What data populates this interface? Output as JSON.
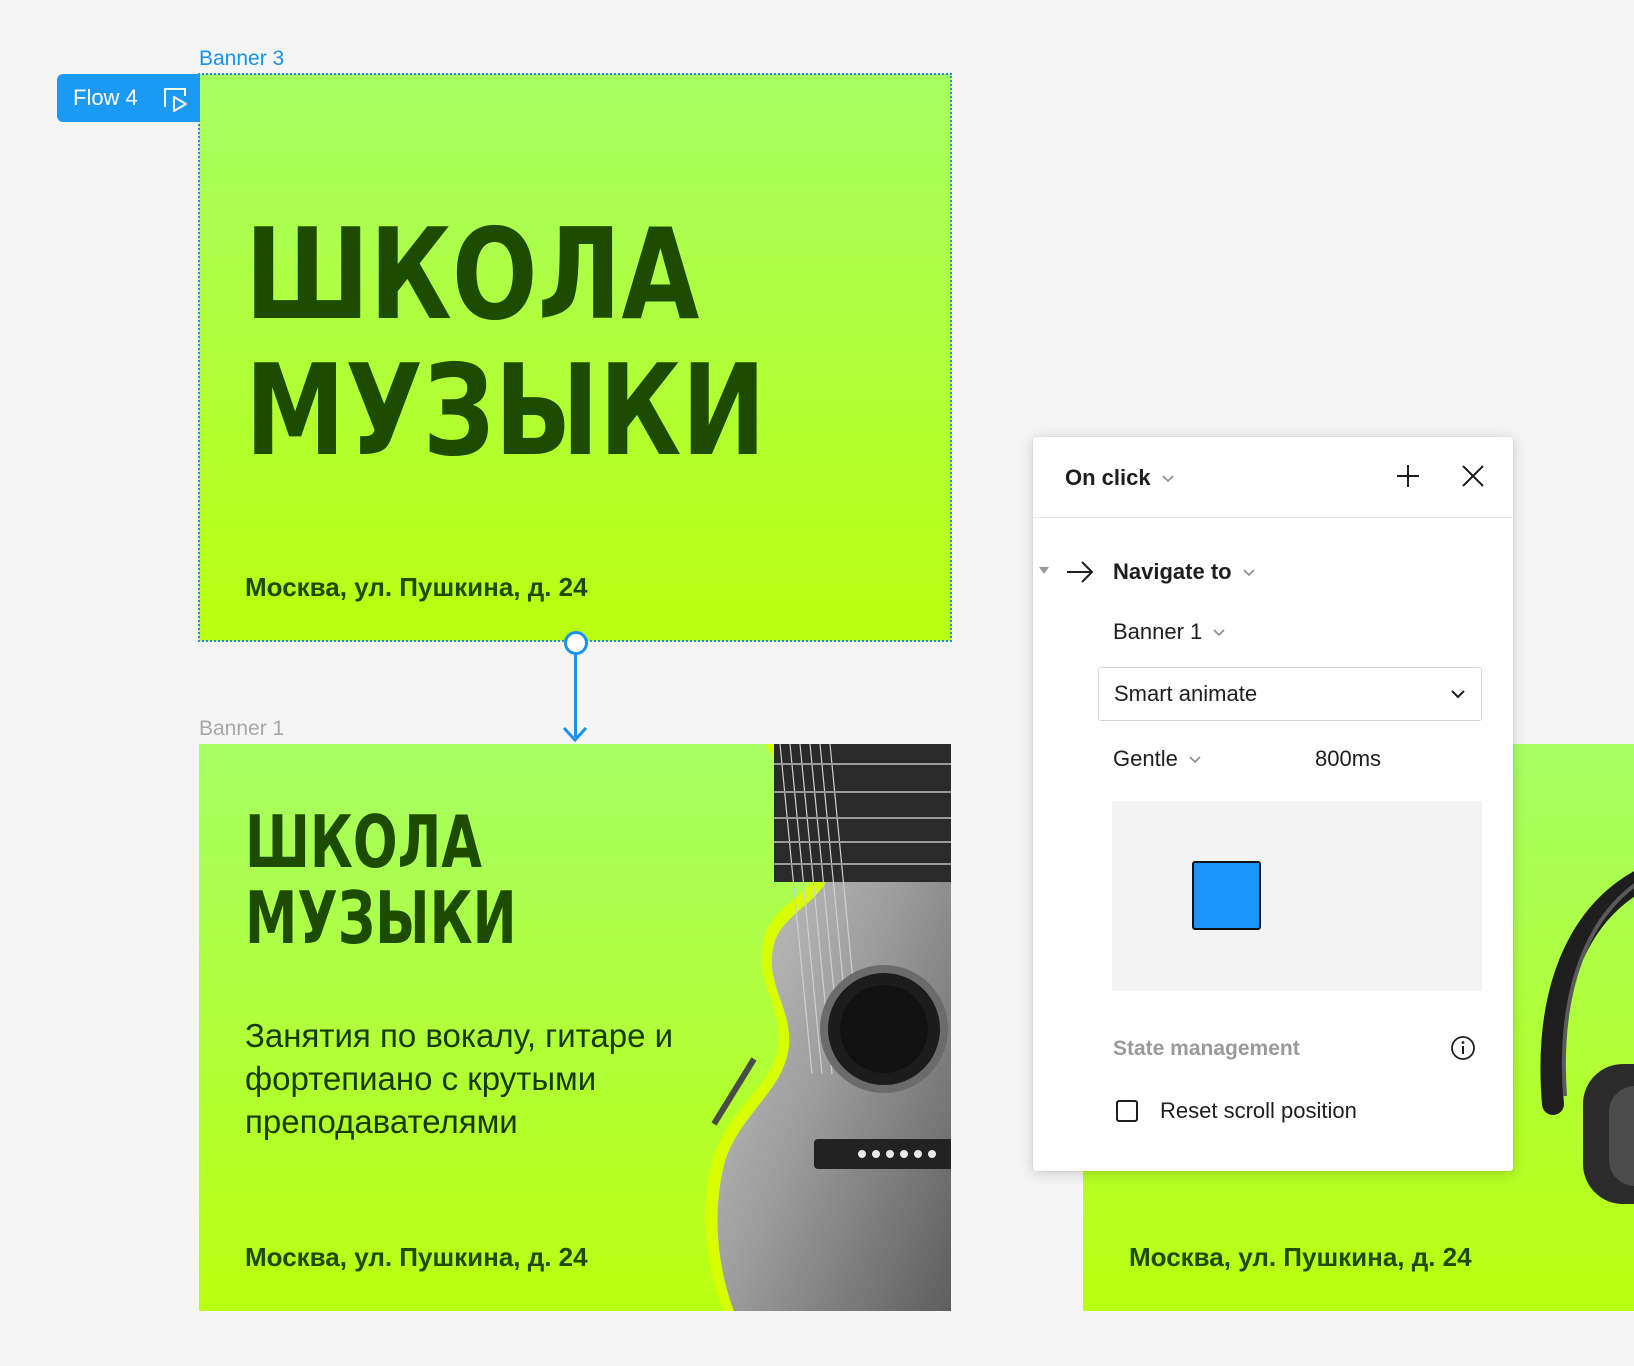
{
  "canvas": {
    "frames": {
      "banner3_label": "Banner 3",
      "banner1_label": "Banner 1"
    },
    "flow_tag": {
      "label": "Flow 4",
      "icon": "play-frame-icon",
      "color": "#1b9af5"
    },
    "banner3": {
      "title_line1": "ШКОЛА",
      "title_line2": "МУЗЫКИ",
      "address": "Москва, ул. Пушкина, д. 24"
    },
    "banner1": {
      "title_line1": "ШКОЛА",
      "title_line2": "МУЗЫКИ",
      "subtitle": "Занятия по вокалу, гитаре и фортепиано с крутыми преподавателями",
      "address": "Москва, ул. Пушкина, д. 24",
      "image": "guitar"
    },
    "banner2": {
      "address": "Москва, ул. Пушкина, д. 24",
      "image": "headphones"
    },
    "colors": {
      "banner_gradient_top": "#a7ff63",
      "banner_gradient_bottom": "#b9ff10",
      "banner_text": "#1d4b00",
      "selection_blue": "#1a92f0"
    }
  },
  "interaction_panel": {
    "trigger": "On click",
    "add_icon": "plus-icon",
    "close_icon": "close-icon",
    "action": {
      "icon": "arrow-right-icon",
      "label": "Navigate to"
    },
    "destination": "Banner 1",
    "animation": "Smart animate",
    "easing": "Gentle",
    "duration": "800ms",
    "preview_color": "#1a96fb",
    "state_management_label": "State management",
    "reset_scroll_label": "Reset scroll position",
    "reset_scroll_checked": false
  }
}
